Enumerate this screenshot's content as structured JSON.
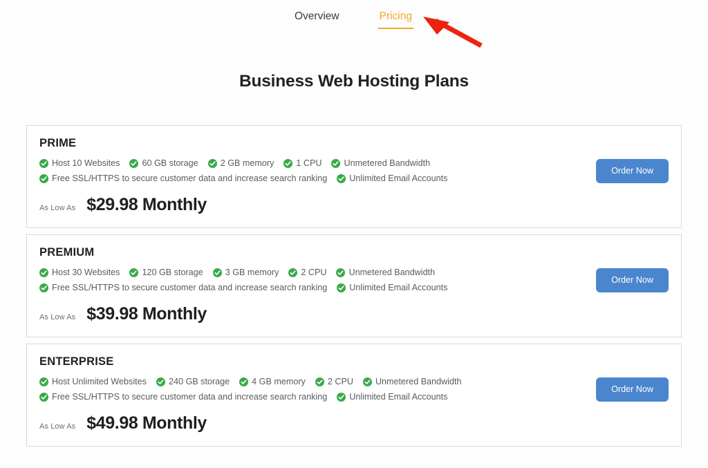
{
  "nav": {
    "tabs": [
      {
        "label": "Overview",
        "active": false
      },
      {
        "label": "Pricing",
        "active": true
      }
    ],
    "accent_color": "#f5a623"
  },
  "page": {
    "title": "Business Web Hosting Plans",
    "background_color": "#fdfdfd"
  },
  "annotation": {
    "type": "arrow",
    "color": "#ee2211",
    "points_to": "Pricing"
  },
  "theme": {
    "check_color": "#3aaa4a",
    "button_color": "#4a86ce",
    "card_border_color": "#d8d8d8"
  },
  "plans": [
    {
      "name": "PRIME",
      "features_row1": [
        "Host 10 Websites",
        "60 GB storage",
        "2 GB memory",
        "1 CPU",
        "Unmetered Bandwidth"
      ],
      "features_row2": [
        "Free SSL/HTTPS to secure customer data and increase search ranking",
        "Unlimited Email Accounts"
      ],
      "price_label": "As Low As",
      "price": "$29.98 Monthly",
      "button": "Order Now"
    },
    {
      "name": "PREMIUM",
      "features_row1": [
        "Host 30 Websites",
        "120 GB storage",
        "3 GB memory",
        "2 CPU",
        "Unmetered Bandwidth"
      ],
      "features_row2": [
        "Free SSL/HTTPS to secure customer data and increase search ranking",
        "Unlimited Email Accounts"
      ],
      "price_label": "As Low As",
      "price": "$39.98 Monthly",
      "button": "Order Now"
    },
    {
      "name": "ENTERPRISE",
      "features_row1": [
        "Host Unlimited Websites",
        "240 GB storage",
        "4 GB memory",
        "2 CPU",
        "Unmetered Bandwidth"
      ],
      "features_row2": [
        "Free SSL/HTTPS to secure customer data and increase search ranking",
        "Unlimited Email Accounts"
      ],
      "price_label": "As Low As",
      "price": "$49.98 Monthly",
      "button": "Order Now"
    }
  ]
}
